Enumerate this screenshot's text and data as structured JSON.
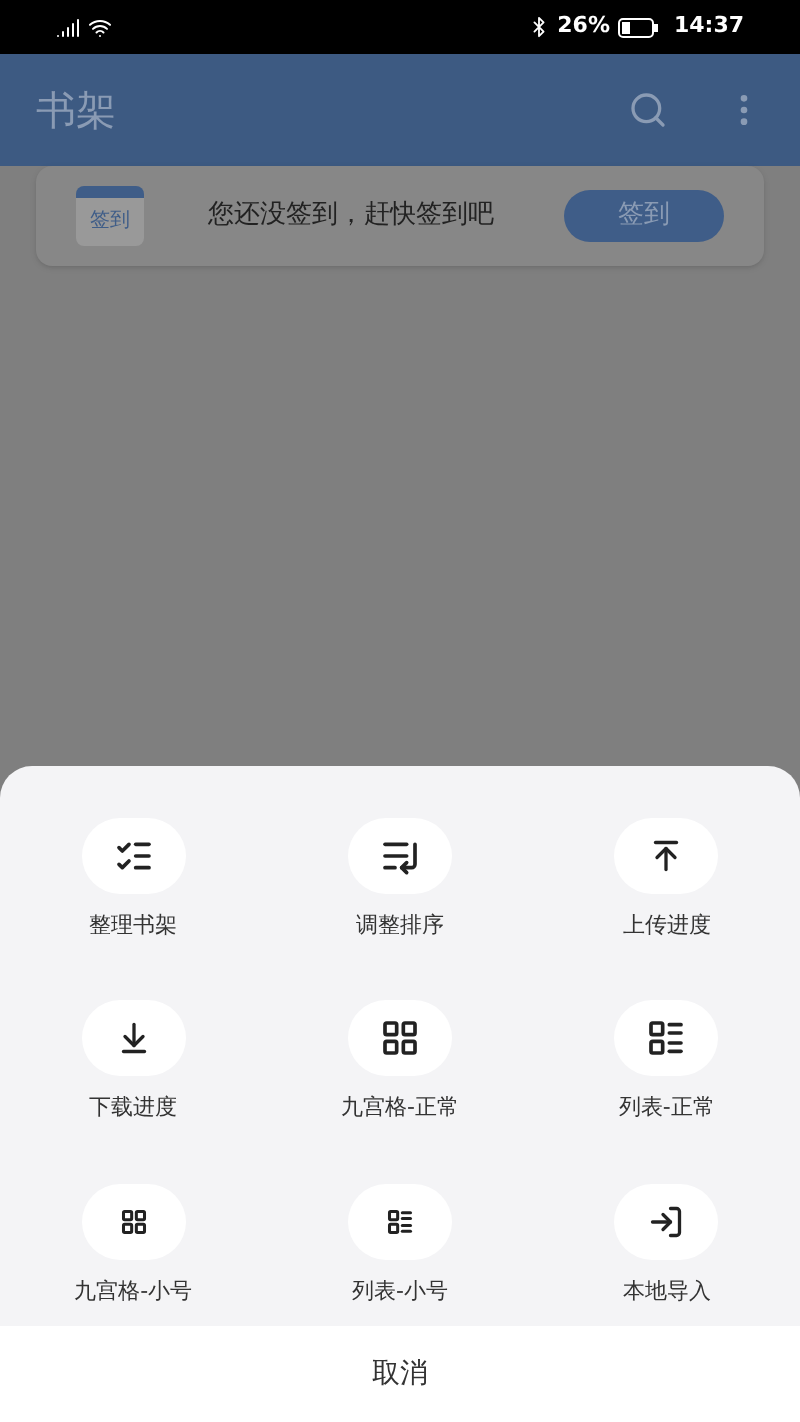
{
  "status_bar": {
    "battery": "26%",
    "time": "14:37"
  },
  "app_bar": {
    "title": "书架"
  },
  "sign_in_card": {
    "icon_label": "签到",
    "message": "您还没签到，赶快签到吧",
    "button": "签到"
  },
  "sheet": {
    "items": [
      {
        "kind": "organize",
        "label": "整理书架"
      },
      {
        "kind": "sort",
        "label": "调整排序"
      },
      {
        "kind": "upload",
        "label": "上传进度"
      },
      {
        "kind": "download",
        "label": "下载进度"
      },
      {
        "kind": "grid",
        "label": "九宫格-正常"
      },
      {
        "kind": "list",
        "label": "列表-正常"
      },
      {
        "kind": "grid-small",
        "label": "九宫格-小号"
      },
      {
        "kind": "list-small",
        "label": "列表-小号"
      },
      {
        "kind": "import",
        "label": "本地导入"
      }
    ],
    "cancel": "取消"
  }
}
